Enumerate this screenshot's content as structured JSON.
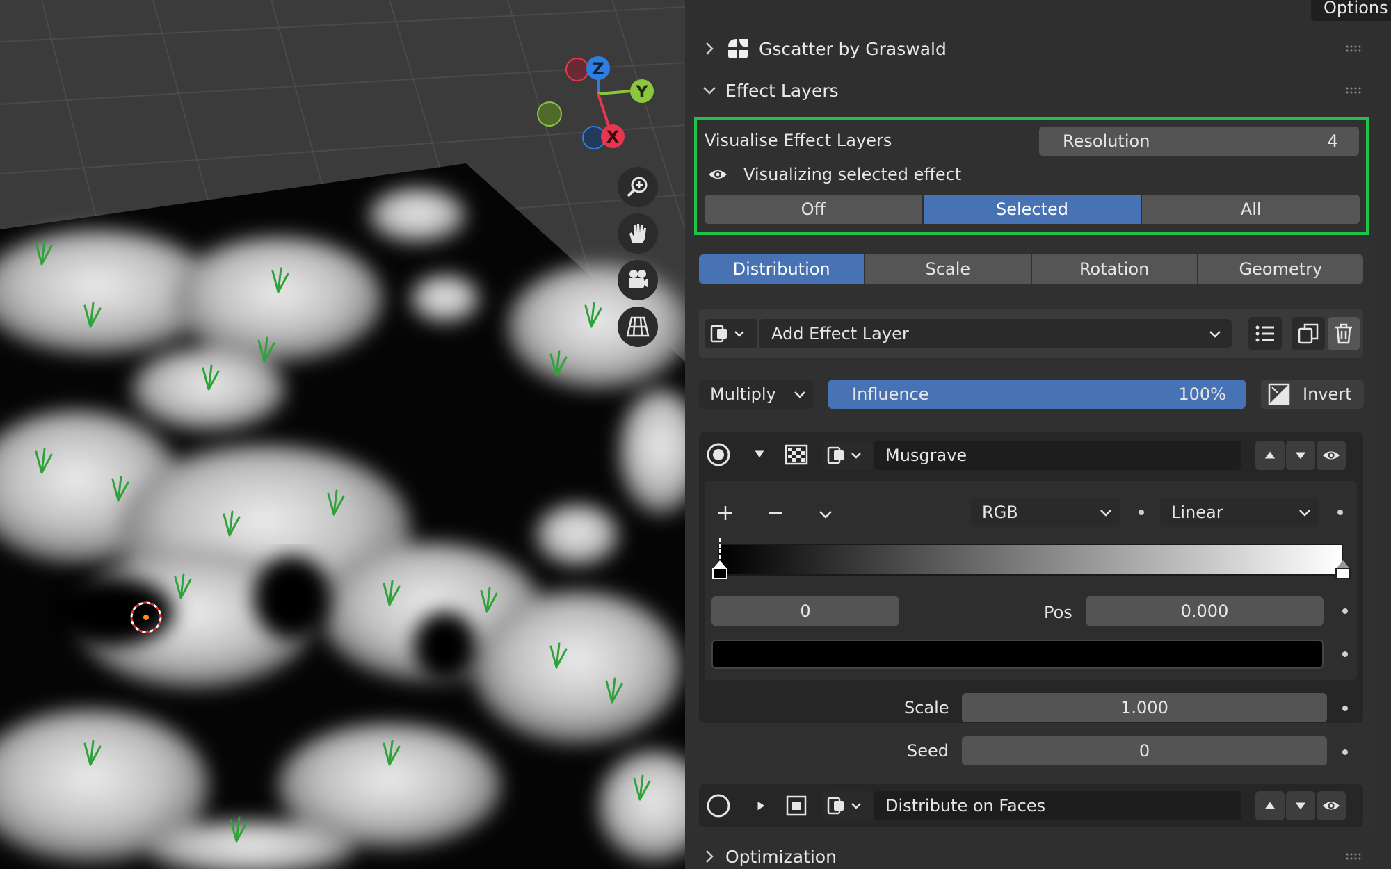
{
  "options_tab": "Options",
  "panels": {
    "gscatter": {
      "title": "Gscatter by Graswald"
    },
    "effect_layers": {
      "title": "Effect Layers",
      "visualise_label": "Visualise Effect Layers",
      "resolution_label": "Resolution",
      "resolution_value": "4",
      "visualizing_text": "Visualizing selected effect",
      "visualize_modes": [
        "Off",
        "Selected",
        "All"
      ],
      "visualize_selected": "Selected",
      "tabs": [
        "Distribution",
        "Scale",
        "Rotation",
        "Geometry"
      ],
      "active_tab": "Distribution",
      "add_effect_label": "Add Effect Layer",
      "blend_mode": "Multiply",
      "influence_label": "Influence",
      "influence_value": "100%",
      "influence_fraction": 1.0,
      "invert_label": "Invert",
      "layers": [
        {
          "name": "Musgrave",
          "selected": true,
          "expanded": true
        },
        {
          "name": "Distribute on Faces",
          "selected": false,
          "expanded": false
        }
      ],
      "color_ramp": {
        "color_mode": "RGB",
        "interpolation": "Linear",
        "stop_index": "0",
        "pos_label": "Pos",
        "pos_value": "0.000",
        "stop_color": "#000000"
      },
      "scale_label": "Scale",
      "scale_value": "1.000",
      "seed_label": "Seed",
      "seed_value": "0"
    },
    "optimization": {
      "title": "Optimization"
    }
  },
  "gizmo": {
    "z": "Z",
    "y": "Y",
    "x": "X"
  },
  "colors": {
    "accent": "#4772b3",
    "highlight": "#1fc24a",
    "axis_x": "#e8364f",
    "axis_y": "#8cc63f",
    "axis_z": "#2f7fe0"
  }
}
